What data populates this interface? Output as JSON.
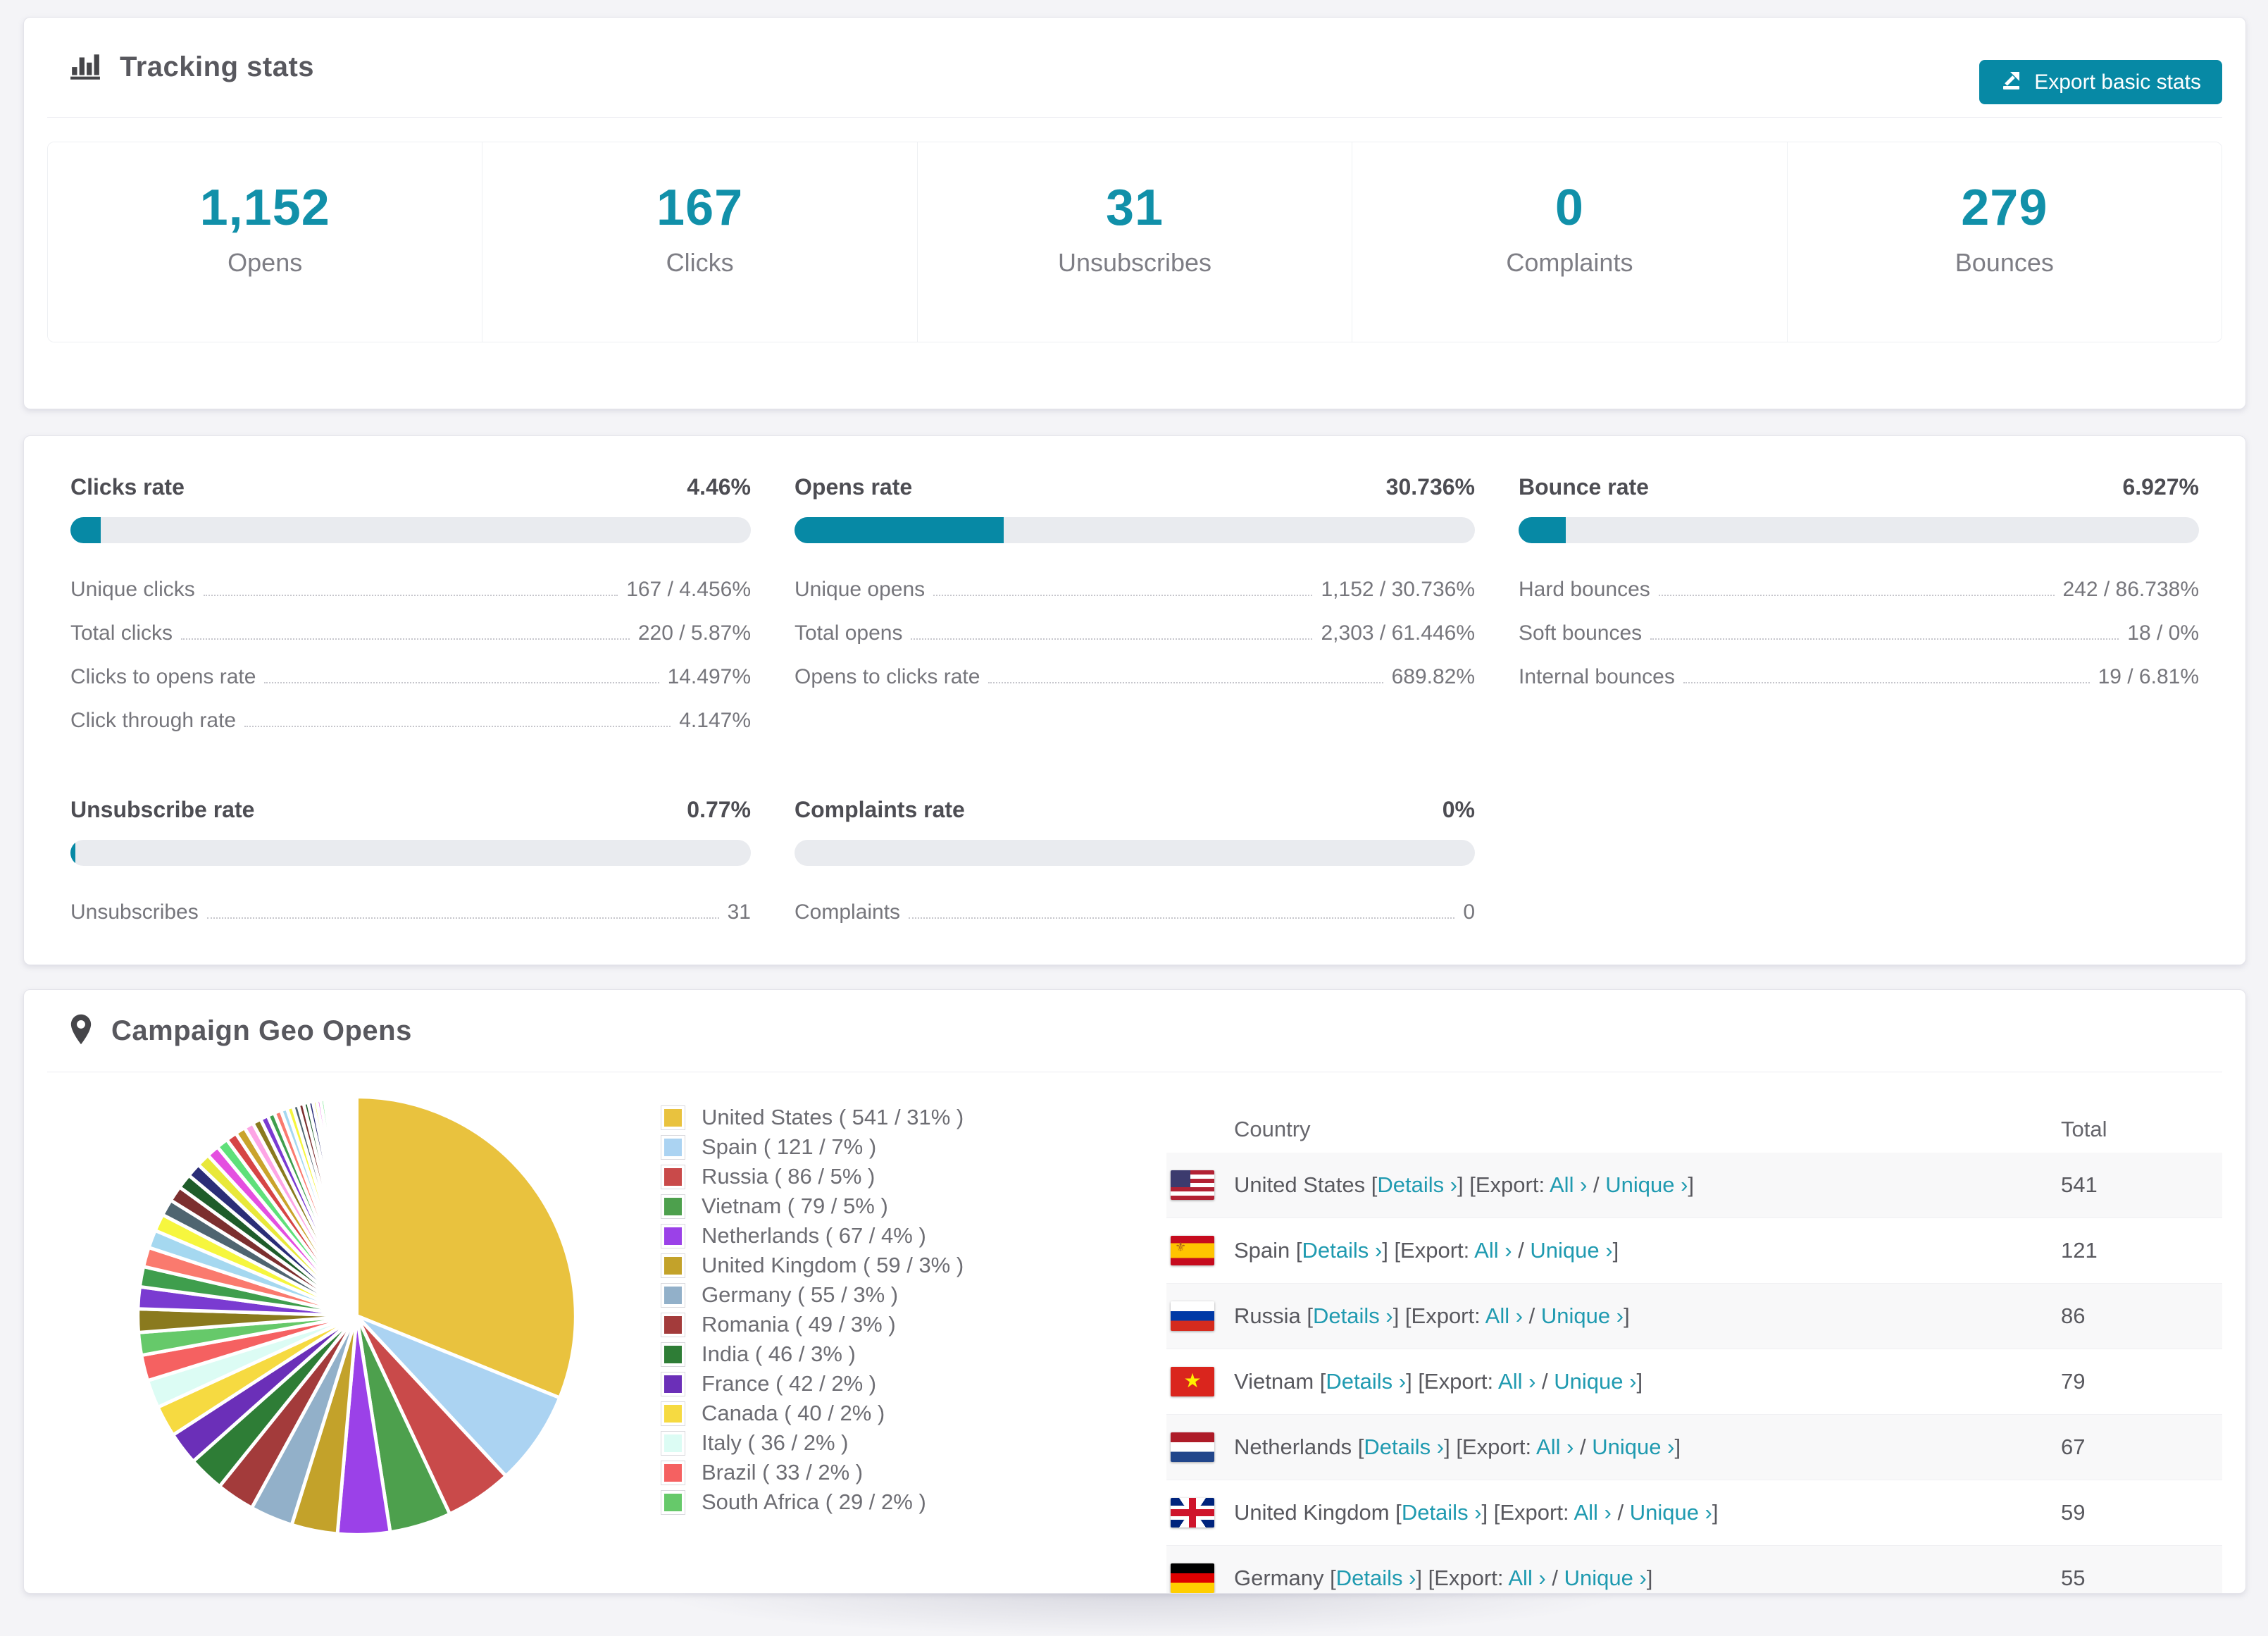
{
  "page": {
    "background": "#f4f4f7",
    "accent": "#0789a5",
    "accent_bright": "#1190a9",
    "link_color": "#1f9ab0"
  },
  "tracking": {
    "title": "Tracking stats",
    "export_button_label": "Export basic stats",
    "stats": [
      {
        "value": "1,152",
        "label": "Opens"
      },
      {
        "value": "167",
        "label": "Clicks"
      },
      {
        "value": "31",
        "label": "Unsubscribes"
      },
      {
        "value": "0",
        "label": "Complaints"
      },
      {
        "value": "279",
        "label": "Bounces"
      }
    ]
  },
  "rates": {
    "blocks": [
      {
        "title": "Clicks rate",
        "value": "4.46%",
        "percent": 4.46,
        "rows": [
          {
            "label": "Unique clicks",
            "value": "167 / 4.456%"
          },
          {
            "label": "Total clicks",
            "value": "220 / 5.87%"
          },
          {
            "label": "Clicks to opens rate",
            "value": "14.497%"
          },
          {
            "label": "Click through rate",
            "value": "4.147%"
          }
        ]
      },
      {
        "title": "Opens rate",
        "value": "30.736%",
        "percent": 30.736,
        "rows": [
          {
            "label": "Unique opens",
            "value": "1,152 / 30.736%"
          },
          {
            "label": "Total opens",
            "value": "2,303 / 61.446%"
          },
          {
            "label": "Opens to clicks rate",
            "value": "689.82%"
          }
        ]
      },
      {
        "title": "Bounce rate",
        "value": "6.927%",
        "percent": 6.927,
        "rows": [
          {
            "label": "Hard bounces",
            "value": "242 / 86.738%"
          },
          {
            "label": "Soft bounces",
            "value": "18 / 0%"
          },
          {
            "label": "Internal bounces",
            "value": "19 / 6.81%"
          }
        ]
      },
      {
        "title": "Unsubscribe rate",
        "value": "0.77%",
        "percent": 0.77,
        "rows": [
          {
            "label": "Unsubscribes",
            "value": "31"
          }
        ]
      },
      {
        "title": "Complaints rate",
        "value": "0%",
        "percent": 0,
        "rows": [
          {
            "label": "Complaints",
            "value": "0"
          }
        ]
      }
    ]
  },
  "geo": {
    "title": "Campaign Geo Opens",
    "chart_data": {
      "type": "pie",
      "title": "Campaign Geo Opens",
      "labels": [
        "United States",
        "Spain",
        "Russia",
        "Vietnam",
        "Netherlands",
        "United Kingdom",
        "Germany",
        "Romania",
        "India",
        "France",
        "Canada",
        "Italy",
        "Brazil",
        "South Africa"
      ],
      "values": [
        541,
        121,
        86,
        79,
        67,
        59,
        55,
        49,
        46,
        42,
        40,
        36,
        33,
        29
      ],
      "percent_labels": [
        "31%",
        "7%",
        "5%",
        "5%",
        "4%",
        "3%",
        "3%",
        "3%",
        "3%",
        "2%",
        "2%",
        "2%",
        "2%",
        "2%"
      ],
      "colors": [
        "#e9c23e",
        "#abd3f2",
        "#c94a4a",
        "#4da04d",
        "#9b41e8",
        "#c3a22a",
        "#92b0c9",
        "#a33b3b",
        "#2e7d36",
        "#6b2fb8",
        "#f6da41",
        "#dcfcf4",
        "#f56161",
        "#66c96a"
      ],
      "start_angle_deg": -90,
      "direction": "clockwise",
      "legend_position": "right",
      "others": {
        "values": [
          30,
          28,
          26,
          25,
          23,
          22,
          21,
          20,
          19,
          18,
          17,
          16,
          15,
          14,
          13,
          12,
          11,
          10,
          9,
          9,
          8,
          8,
          7,
          7,
          6,
          6,
          5,
          5,
          5,
          4,
          4,
          4,
          3,
          3,
          3,
          3,
          2,
          2,
          2,
          2,
          2,
          1,
          1,
          1,
          1,
          1,
          1,
          1
        ],
        "palette": [
          "#8a7a1e",
          "#7a3bd1",
          "#3f9e4d",
          "#fa7a6e",
          "#a5d8f0",
          "#f6f63e",
          "#4f6570",
          "#7c2f2f",
          "#1f5c2a",
          "#2b2d77",
          "#e8e83a",
          "#e44fe0",
          "#5fe07a",
          "#d64545",
          "#caa32b",
          "#fda5e5"
        ]
      }
    },
    "legend_format": {
      "open": "( ",
      "sep": " / ",
      "close": " )"
    },
    "table": {
      "headers": {
        "country": "Country",
        "total": "Total"
      },
      "link_labels": {
        "details": "Details ›",
        "export_prefix": "[Export: ",
        "all": "All ›",
        "unique": "Unique ›",
        "slash": " / "
      },
      "rows": [
        {
          "country": "United States",
          "flag": "us",
          "total": "541"
        },
        {
          "country": "Spain",
          "flag": "es",
          "total": "121"
        },
        {
          "country": "Russia",
          "flag": "ru",
          "total": "86"
        },
        {
          "country": "Vietnam",
          "flag": "vn",
          "total": "79"
        },
        {
          "country": "Netherlands",
          "flag": "nl",
          "total": "67"
        },
        {
          "country": "United Kingdom",
          "flag": "gb",
          "total": "59"
        },
        {
          "country": "Germany",
          "flag": "de",
          "total": "55"
        }
      ]
    }
  }
}
